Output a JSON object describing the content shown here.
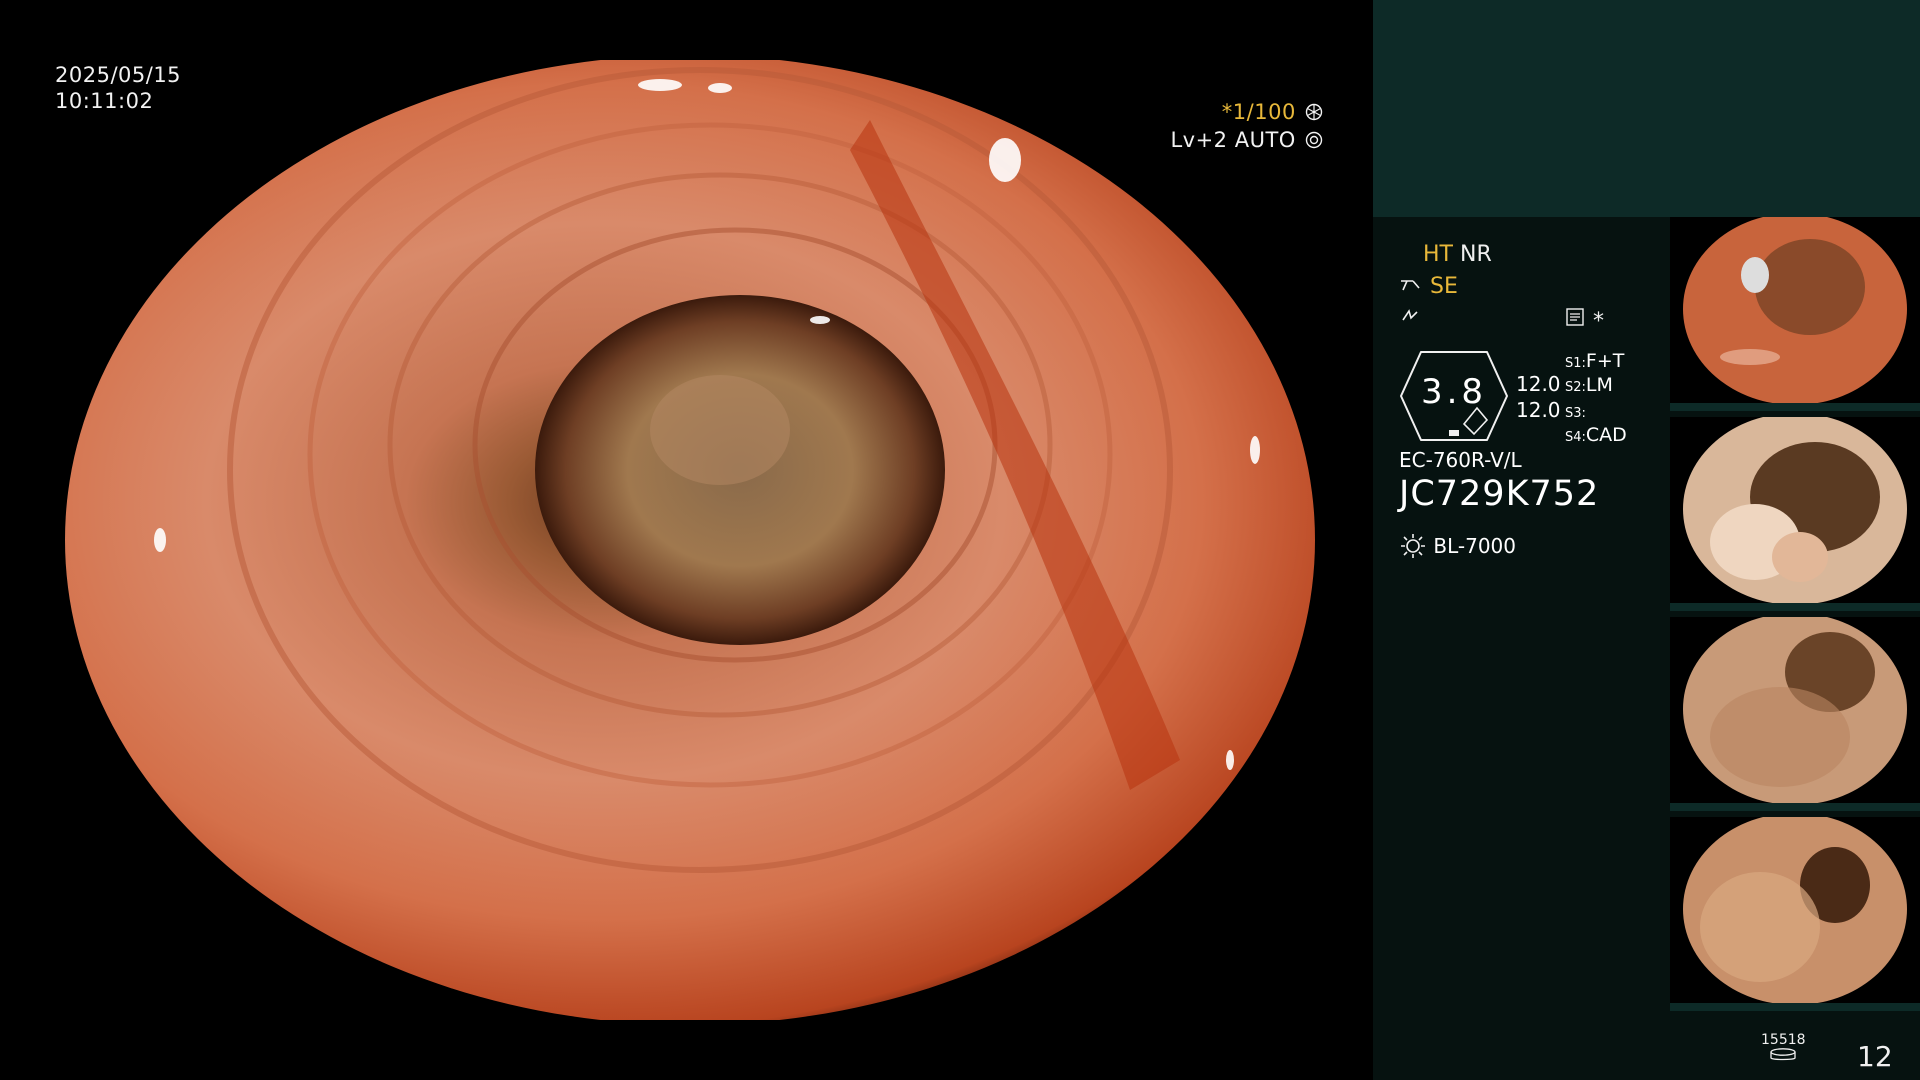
{
  "overlay": {
    "date": "2025/05/15",
    "time": "10:11:02",
    "shutter": "*1/100",
    "level": "Lv+2 AUTO"
  },
  "panel": {
    "ht": "HT",
    "nr": "NR",
    "se": "SE",
    "gauge_value": "3.8",
    "ratio_1": "12.0",
    "ratio_2": "12.0",
    "s1_key": "S1:",
    "s1_val": "F+T",
    "s2_key": "S2:",
    "s2_val": "LM",
    "s3_key": "S3:",
    "s3_val": "",
    "s4_key": "S4:",
    "s4_val": "CAD",
    "asterisk": "*",
    "scope_model": "EC-760R-V/L",
    "scope_serial": "JC729K752",
    "light_source": "BL-7000",
    "memory_count": "15518",
    "image_counter": "12"
  },
  "icons": {
    "shutter_icon": "aperture-icon",
    "level_icon": "iris-icon",
    "se_icon": "structure-enhance-icon",
    "flash_icon": "lightning-icon",
    "memo_icon": "document-icon",
    "light_icon": "lamp-icon",
    "storage_icon": "storage-disk-icon"
  },
  "colors": {
    "accent_yellow": "#e8b83a",
    "panel_bg": "#061210",
    "panel_top": "#0d2a27"
  },
  "thumbnails": [
    {
      "name": "thumbnail-1"
    },
    {
      "name": "thumbnail-2"
    },
    {
      "name": "thumbnail-3"
    },
    {
      "name": "thumbnail-4"
    }
  ]
}
